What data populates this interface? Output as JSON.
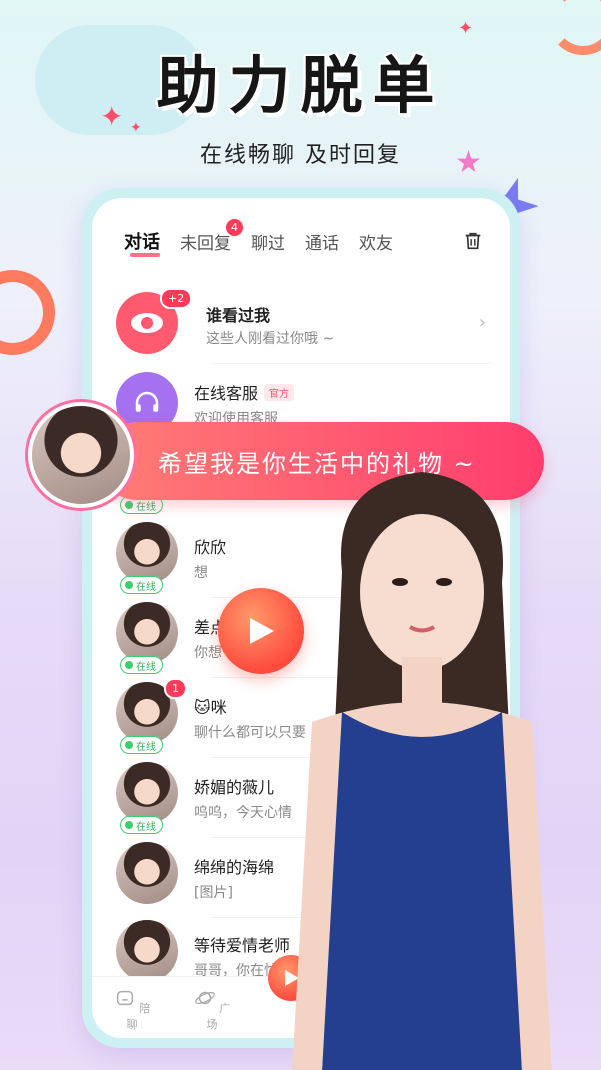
{
  "hero": {
    "title": "助力脱单",
    "subtitle": "在线畅聊  及时回复"
  },
  "tabs": [
    {
      "label": "对话",
      "active": true
    },
    {
      "label": "未回复",
      "badge": "4"
    },
    {
      "label": "聊过"
    },
    {
      "label": "通话"
    },
    {
      "label": "欢友"
    }
  ],
  "rows": {
    "viewers": {
      "name": "谁看过我",
      "message": "这些人刚看过你哦 ~",
      "badge": "+2"
    },
    "service": {
      "name": "在线客服",
      "tag": "官方",
      "message": "欢迎使用客服"
    },
    "online_label": "在线",
    "contacts": [
      {
        "name": "欣欣",
        "message": "想",
        "online": true
      },
      {
        "name": "差点",
        "message": "你想                           活?",
        "online": true
      },
      {
        "name": "🐱咪",
        "message": "聊什么都可以只要",
        "online": true,
        "badge": "1"
      },
      {
        "name": "娇媚的薇儿",
        "message": "呜呜，今天心情",
        "online": true
      },
      {
        "name": "绵绵的海绵",
        "message": "[图片]",
        "online": false
      },
      {
        "name": "等待爱情老师",
        "message": "哥哥，你在忙",
        "online": false
      }
    ]
  },
  "bubble": {
    "text": "希望我是你生活中的礼物 ~"
  },
  "bottom_nav": [
    {
      "label": "陪聊",
      "icon": "home-icon"
    },
    {
      "label": "广场",
      "icon": "planet-icon"
    }
  ],
  "colors": {
    "accent": "#ff3b57",
    "online": "#3ccf6e",
    "bubble_start": "#ff7d75",
    "bubble_end": "#ff3d6e"
  }
}
